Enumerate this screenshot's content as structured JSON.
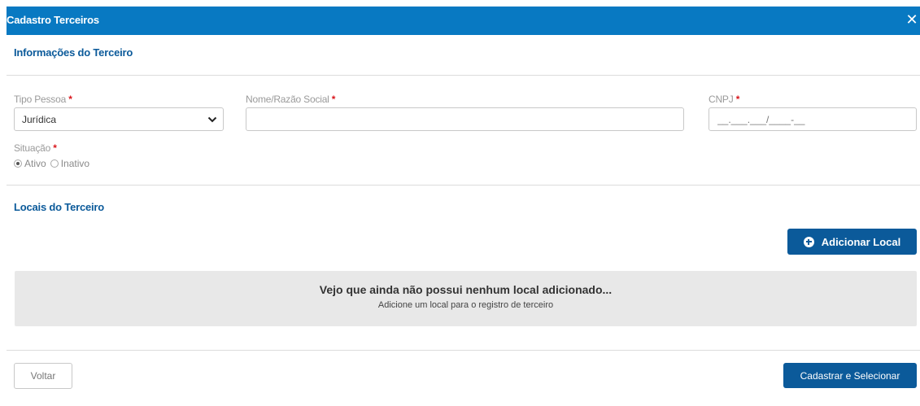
{
  "modal": {
    "title": "Cadastro Terceiros",
    "close_symbol": "✕"
  },
  "info_section": {
    "title": "Informações do Terceiro",
    "tipo_pessoa": {
      "label": "Tipo Pessoa",
      "required_mark": "*",
      "selected": "Jurídica"
    },
    "nome": {
      "label": "Nome/Razão Social",
      "required_mark": "*",
      "value": ""
    },
    "cnpj": {
      "label": "CNPJ",
      "required_mark": "*",
      "placeholder": "__.___.___/____-__"
    },
    "situacao": {
      "label": "Situação",
      "required_mark": "*",
      "options": [
        {
          "label": "Ativo",
          "checked": true
        },
        {
          "label": "Inativo",
          "checked": false
        }
      ]
    }
  },
  "locais_section": {
    "title": "Locais do Terceiro",
    "add_button_label": "Adicionar Local",
    "add_button_icon": "plus-circle-icon",
    "empty_title": "Vejo que ainda não possui nenhum local adicionado...",
    "empty_subtitle": "Adicione um local para o registro de terceiro"
  },
  "footer": {
    "back_label": "Voltar",
    "submit_label": "Cadastrar e Selecionar"
  },
  "colors": {
    "header_bg": "#0879c2",
    "primary_button": "#0b5a9a",
    "section_title": "#0b5a9a",
    "required_mark": "#d9161c",
    "empty_panel_bg": "#e8e8e8"
  }
}
